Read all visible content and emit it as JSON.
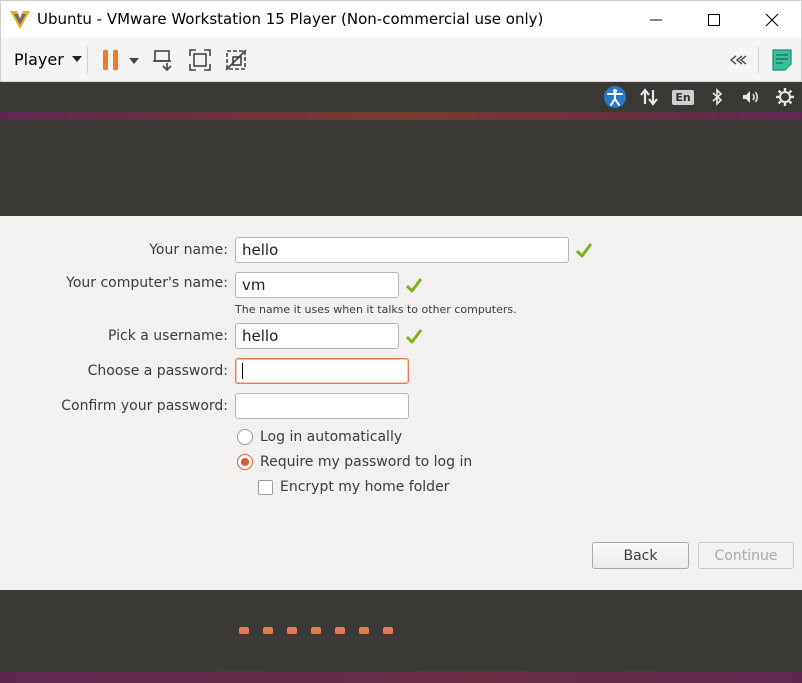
{
  "window": {
    "title": "Ubuntu - VMware Workstation 15 Player (Non-commercial use only)"
  },
  "toolbar": {
    "player_menu_label": "Player",
    "icons": [
      "pause-icon",
      "send-ctrl-alt-del-icon",
      "fullscreen-icon",
      "unity-icon",
      "collapse-icon",
      "notes-icon"
    ]
  },
  "top_panel": {
    "language_indicator": "En",
    "icons": [
      "accessibility-icon",
      "network-icon",
      "bluetooth-icon",
      "volume-icon",
      "power-icon"
    ]
  },
  "form": {
    "your_name": {
      "label": "Your name:",
      "value": "hello"
    },
    "computer_name": {
      "label": "Your computer's name:",
      "value": "vm",
      "hint": "The name it uses when it talks to other computers."
    },
    "username": {
      "label": "Pick a username:",
      "value": "hello"
    },
    "password": {
      "label": "Choose a password:",
      "value": ""
    },
    "confirm_password": {
      "label": "Confirm your password:",
      "value": ""
    },
    "options": {
      "login_auto": "Log in automatically",
      "require_password": "Require my password to log in",
      "encrypt_home": "Encrypt my home folder"
    },
    "selected_option": "require_password"
  },
  "buttons": {
    "back": "Back",
    "continue": "Continue"
  },
  "progress": {
    "total_steps": 7
  },
  "colors": {
    "accent": "#e9794f",
    "radio_accent": "#e05a2a",
    "valid_check": "#7fb21e",
    "pause": "#f07a2a",
    "panel_dark": "#3c3b37",
    "aubergine": "#5e2750"
  }
}
